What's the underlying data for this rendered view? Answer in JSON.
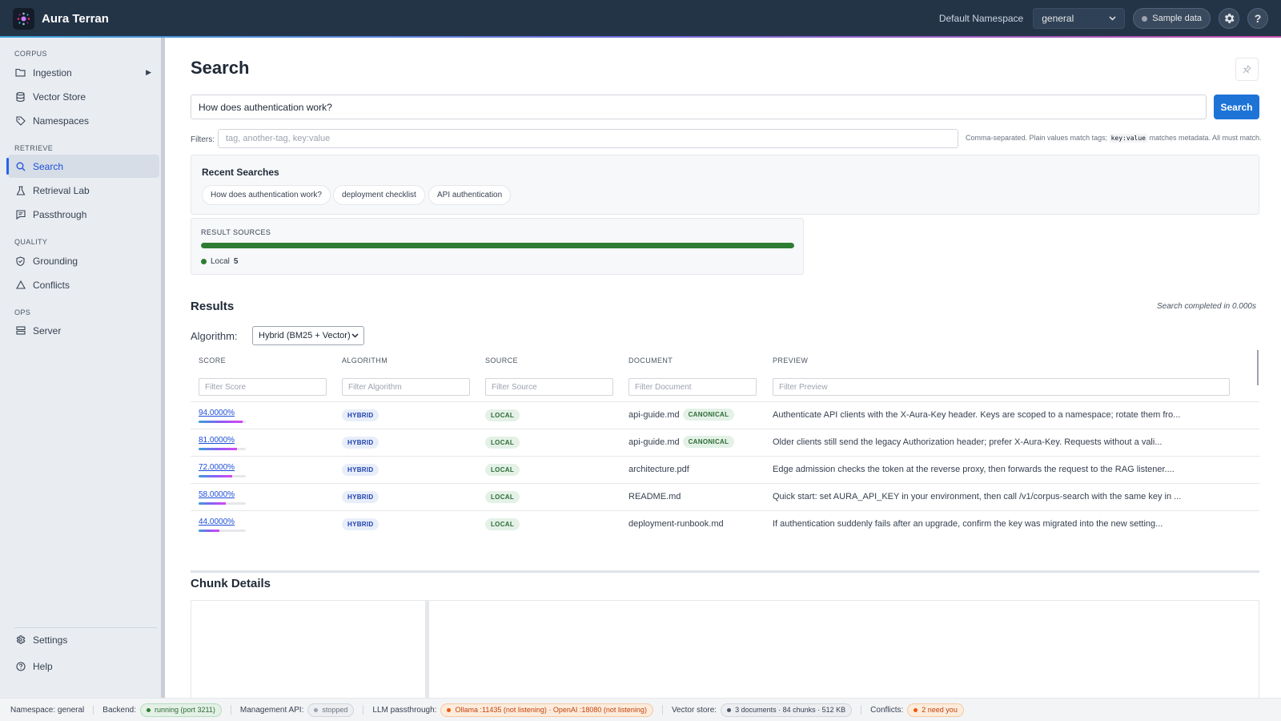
{
  "app": {
    "brand": "Aura Terran",
    "namespace_label": "Default Namespace",
    "namespace_value": "general",
    "sample_data_label": "Sample data",
    "help_label": "?"
  },
  "sidebar": {
    "sections": [
      {
        "title": "CORPUS"
      },
      {
        "title": "RETRIEVE"
      },
      {
        "title": "QUALITY"
      },
      {
        "title": "OPS"
      }
    ],
    "items": [
      {
        "label": "Ingestion",
        "icon": "folder-icon"
      },
      {
        "label": "Vector Store",
        "icon": "database-icon"
      },
      {
        "label": "Namespaces",
        "icon": "tag-icon"
      },
      {
        "label": "Search",
        "icon": "search-icon",
        "active": true
      },
      {
        "label": "Retrieval Lab",
        "icon": "flask-icon"
      },
      {
        "label": "Passthrough",
        "icon": "message-icon"
      },
      {
        "label": "Grounding",
        "icon": "shield-icon"
      },
      {
        "label": "Conflicts",
        "icon": "warning-icon"
      },
      {
        "label": "Server",
        "icon": "server-icon"
      }
    ],
    "footer": [
      {
        "label": "Settings",
        "icon": "gear-icon"
      },
      {
        "label": "Help",
        "icon": "help-icon"
      }
    ]
  },
  "main": {
    "title": "Search",
    "query": "How does authentication work?",
    "search_button": "Search",
    "filters_label": "Filters:",
    "filters_placeholder": "tag, another-tag, key:value",
    "filters_hint_pre": "Comma-separated. Plain values match tags;",
    "filters_hint_code": "key:value",
    "filters_hint_post": "matches metadata. All must match.",
    "recent_title": "Recent Searches",
    "recent": [
      "How does authentication work?",
      "deployment checklist",
      "API authentication"
    ],
    "sources_title": "RESULT SOURCES",
    "sources": [
      {
        "name": "Local",
        "count": "5",
        "fraction": 1.0,
        "color": "#2e7d32"
      }
    ],
    "results_title": "Results",
    "results_meta": "Search completed in 0.000s",
    "algorithm_label": "Algorithm:",
    "algorithm_value": "Hybrid (BM25 + Vector)",
    "columns": [
      "SCORE",
      "ALGORITHM",
      "SOURCE",
      "DOCUMENT",
      "PREVIEW"
    ],
    "column_filters": [
      "Filter Score",
      "Filter Algorithm",
      "Filter Source",
      "Filter Document",
      "Filter Preview"
    ],
    "rows": [
      {
        "score": "94.0000%",
        "score_fraction": 0.94,
        "algorithm": "HYBRID",
        "source": "LOCAL",
        "document": "api-guide.md",
        "canonical": "CANONICAL",
        "preview": "Authenticate API clients with the X-Aura-Key header. Keys are scoped to a namespace; rotate them fro..."
      },
      {
        "score": "81.0000%",
        "score_fraction": 0.81,
        "algorithm": "HYBRID",
        "source": "LOCAL",
        "document": "api-guide.md",
        "canonical": "CANONICAL",
        "preview": "Older clients still send the legacy Authorization header; prefer X-Aura-Key. Requests without a vali..."
      },
      {
        "score": "72.0000%",
        "score_fraction": 0.72,
        "algorithm": "HYBRID",
        "source": "LOCAL",
        "document": "architecture.pdf",
        "canonical": "",
        "preview": "Edge admission checks the token at the reverse proxy, then forwards the request to the RAG listener...."
      },
      {
        "score": "58.0000%",
        "score_fraction": 0.58,
        "algorithm": "HYBRID",
        "source": "LOCAL",
        "document": "README.md",
        "canonical": "",
        "preview": "Quick start: set AURA_API_KEY in your environment, then call /v1/corpus-search with the same key in ..."
      },
      {
        "score": "44.0000%",
        "score_fraction": 0.44,
        "algorithm": "HYBRID",
        "source": "LOCAL",
        "document": "deployment-runbook.md",
        "canonical": "",
        "preview": "If authentication suddenly fails after an upgrade, confirm the key was migrated into the new setting..."
      }
    ],
    "chunk_title": "Chunk Details"
  },
  "status": {
    "namespace": "Namespace: general",
    "backend_label": "Backend:",
    "backend_value": "running (port 3211)",
    "mgmt_label": "Management API:",
    "mgmt_value": "stopped",
    "llm_label": "LLM passthrough:",
    "llm_value": "Ollama :11435 (not listening) · OpenAI :18080 (not listening)",
    "vector_label": "Vector store:",
    "vector_value": "3 documents · 84 chunks · 512 KB",
    "conflicts_label": "Conflicts:",
    "conflicts_value": "2 need you"
  },
  "colors": {
    "topbar": "#243447",
    "accent": "#1d73d6",
    "local_green": "#2e7d32"
  }
}
